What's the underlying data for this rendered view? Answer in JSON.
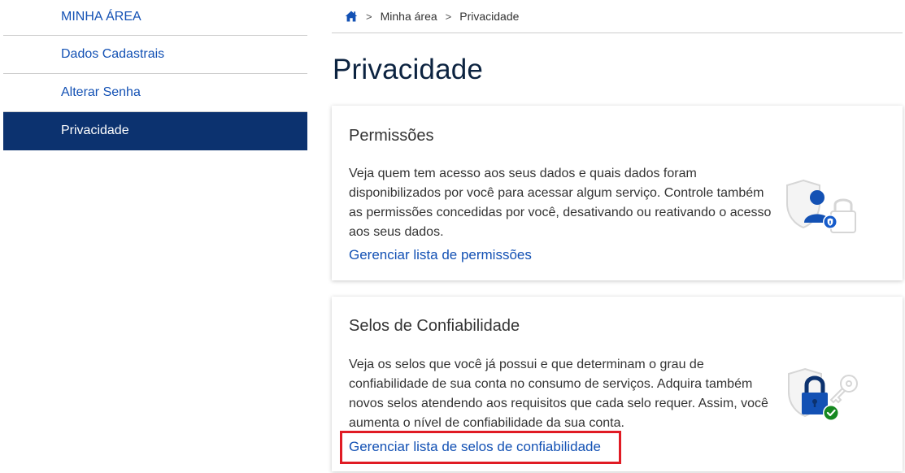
{
  "sidebar": {
    "header": "MINHA ÁREA",
    "items": [
      {
        "label": "Dados Cadastrais"
      },
      {
        "label": "Alterar Senha"
      },
      {
        "label": "Privacidade"
      }
    ]
  },
  "breadcrumb": {
    "home_icon": "home-icon",
    "separator": ">",
    "items": [
      "Minha área",
      "Privacidade"
    ]
  },
  "page": {
    "title": "Privacidade"
  },
  "cards": [
    {
      "title": "Permissões",
      "text": "Veja quem tem acesso aos seus dados e quais dados foram disponibilizados por você para acessar algum serviço. Controle também as permissões concedidas por você, desativando ou reativando o acesso aos seus dados.",
      "link": "Gerenciar lista de permissões",
      "icon": "user-shield-lock-illustration"
    },
    {
      "title": "Selos de Confiabilidade",
      "text": "Veja os selos que você já possui e que determinam o grau de confiabilidade de sua conta no consumo de serviços. Adquira também novos selos atendendo aos requisitos que cada selo requer. Assim, você aumenta o nível de confiabilidade da sua conta.",
      "link": "Gerenciar lista de selos de confiabilidade",
      "icon": "padlock-key-check-illustration"
    }
  ],
  "colors": {
    "primary": "#1351b4",
    "sidebar_active_bg": "#0c326f",
    "title": "#0c2340",
    "highlight": "#e01b24",
    "success": "#168821"
  }
}
